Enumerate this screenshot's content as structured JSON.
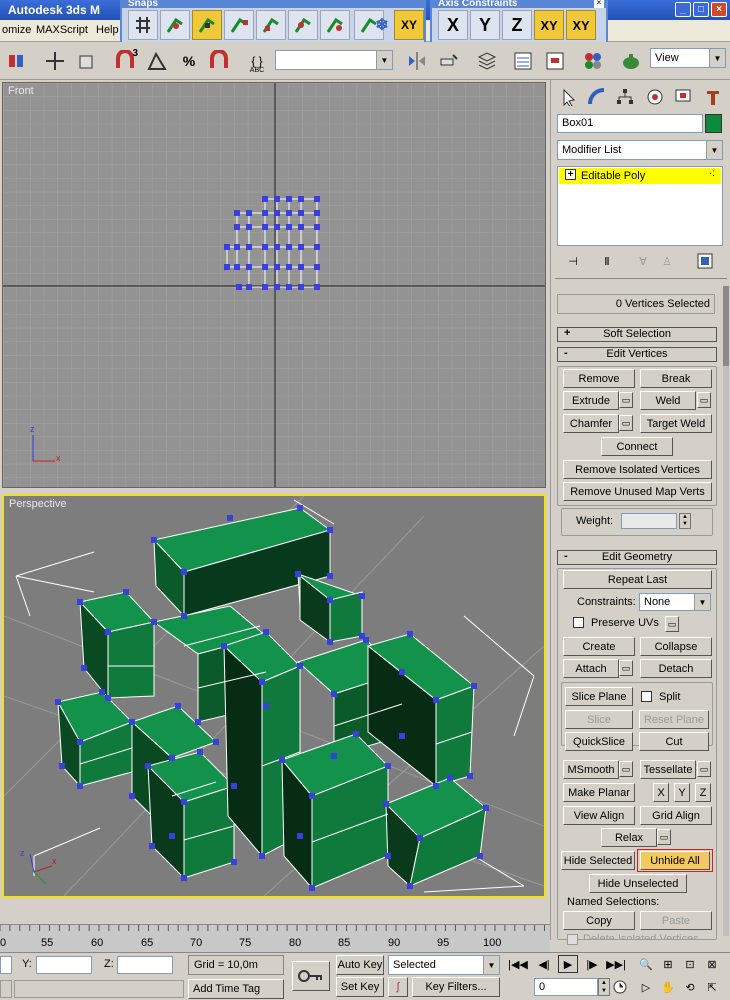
{
  "window": {
    "title": "Autodesk 3ds M"
  },
  "menu": [
    "omize",
    "MAXScript",
    "Help"
  ],
  "snaps_toolbar": {
    "title": "Snaps",
    "xy_label": "XY"
  },
  "axis_toolbar": {
    "title": "Axis Constraints",
    "x": "X",
    "y": "Y",
    "z": "Z",
    "xy": "XY",
    "xy2": "XY"
  },
  "main_toolbar": {
    "ref_coord": "View",
    "snap_label": "3",
    "percent_label": "%",
    "abc_label": "ABC"
  },
  "viewports": {
    "front_label": "Front",
    "persp_label": "Perspective"
  },
  "axes": {
    "x": "x",
    "z": "z"
  },
  "command_panel": {
    "object_name": "Box01",
    "object_color": "#0e8a3c",
    "modifier_list": "Modifier List",
    "stack_item": "Editable Poly",
    "stack_sign": "+",
    "selection_info": "0 Vertices Selected",
    "soft_selection": {
      "sign": "+",
      "label": "Soft Selection"
    },
    "edit_vertices": {
      "sign": "-",
      "label": "Edit Vertices",
      "remove": "Remove",
      "break": "Break",
      "extrude": "Extrude",
      "weld": "Weld",
      "chamfer": "Chamfer",
      "target_weld": "Target Weld",
      "connect": "Connect",
      "remove_isolated": "Remove Isolated Vertices",
      "remove_unused": "Remove Unused Map Verts",
      "weight_label": "Weight:"
    },
    "edit_geometry": {
      "sign": "-",
      "label": "Edit Geometry",
      "repeat_last": "Repeat Last",
      "constraints_label": "Constraints:",
      "constraints_value": "None",
      "preserve_uvs": "Preserve UVs",
      "create": "Create",
      "collapse": "Collapse",
      "attach": "Attach",
      "detach": "Detach",
      "slice_plane": "Slice Plane",
      "split": "Split",
      "slice": "Slice",
      "reset_plane": "Reset Plane",
      "quickslice": "QuickSlice",
      "cut": "Cut",
      "msmooth": "MSmooth",
      "tessellate": "Tessellate",
      "make_planar": "Make Planar",
      "x": "X",
      "y": "Y",
      "z": "Z",
      "view_align": "View Align",
      "grid_align": "Grid Align",
      "relax": "Relax",
      "hide_selected": "Hide Selected",
      "unhide_all": "Unhide All",
      "hide_unselected": "Hide Unselected",
      "named_selections": "Named Selections:",
      "copy": "Copy",
      "paste": "Paste",
      "delete_isolated": "Delete Isolated Vertices"
    }
  },
  "timeline": {
    "ticks": [
      "0",
      "55",
      "60",
      "65",
      "70",
      "75",
      "80",
      "85",
      "90",
      "95",
      "100"
    ]
  },
  "status_bar": {
    "y_label": "Y:",
    "z_label": "Z:",
    "grid": "Grid = 10,0m",
    "auto_key": "Auto Key",
    "key_mode": "Selected",
    "set_key": "Set Key",
    "key_filters": "Key Filters...",
    "add_time_tag": "Add Time Tag",
    "frame": "0"
  }
}
